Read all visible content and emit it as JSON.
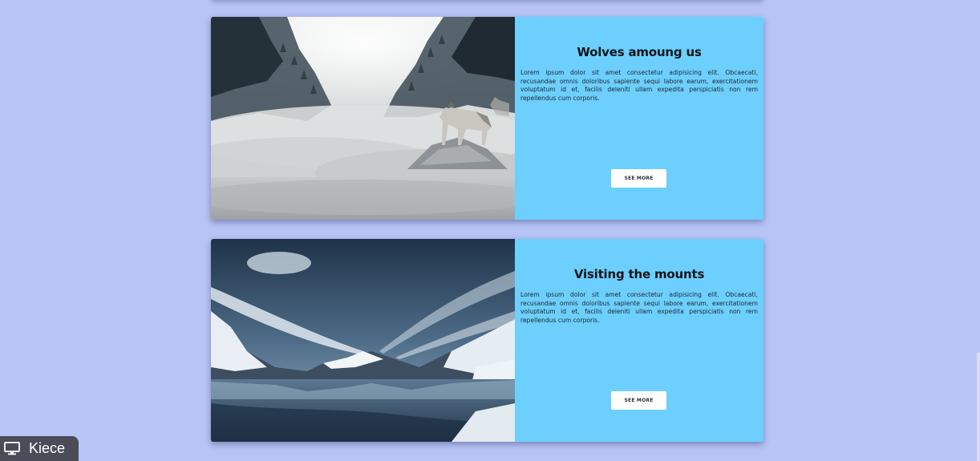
{
  "cards": [
    {
      "title": "Wolves amoung us",
      "text": "Lorem ipsum dolor sit amet consectetur adipisicing elit. Obcaecati, recusandae omnis doloribus sapiente sequi labore earum, exercitationem voluptatum id et, facilis deleniti ullam expedita perspiciatis non rem repellendus cum corporis.",
      "button_label": "SEE MORE"
    },
    {
      "title": "Visiting the mounts",
      "text": "Lorem ipsum dolor sit amet consectetur adipisicing elit. Obcaecati, recusandae omnis doloribus sapiente sequi labore earum, exercitationem voluptatum id et, facilis deleniti ullam expedita perspiciatis non rem repellendus cum corporis.",
      "button_label": "SEE MORE"
    }
  ],
  "taskbar": {
    "label": "Kiece",
    "icon": "monitor-icon"
  },
  "colors": {
    "page_background": "#b8c4f5",
    "card_body": "#6ccffd",
    "button_background": "#ffffff",
    "taskbar_background": "#4a4d57"
  }
}
